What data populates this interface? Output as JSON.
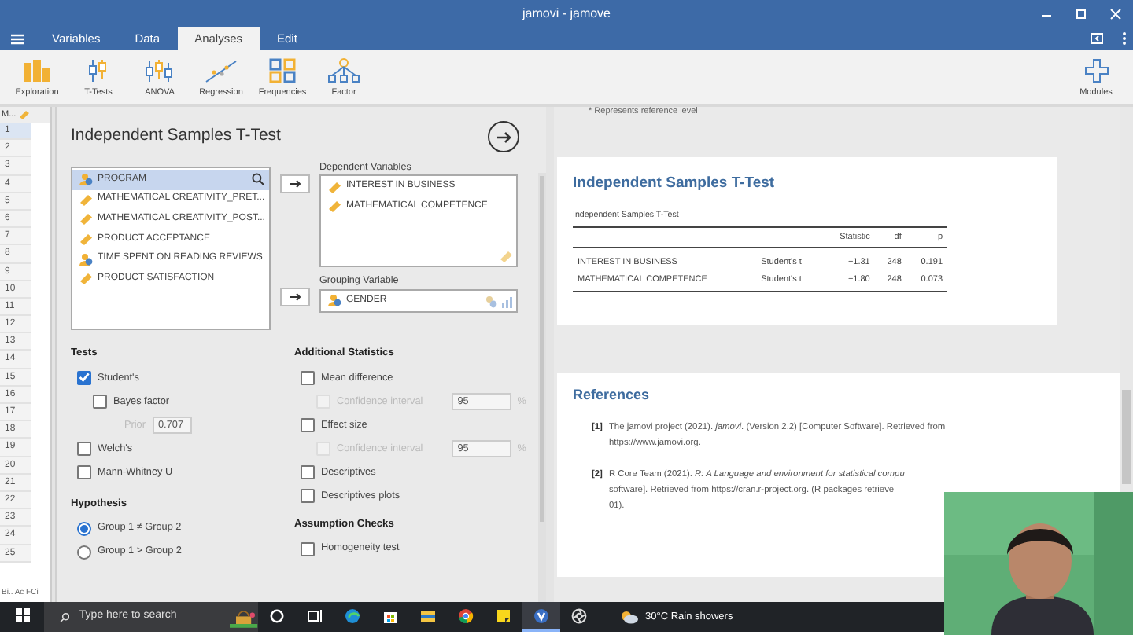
{
  "window": {
    "title": "jamovi - jamove"
  },
  "tabs": [
    {
      "label": "Variables",
      "selected": false
    },
    {
      "label": "Data",
      "selected": false
    },
    {
      "label": "Analyses",
      "selected": true
    },
    {
      "label": "Edit",
      "selected": false
    }
  ],
  "ribbon": [
    "Exploration",
    "T-Tests",
    "ANOVA",
    "Regression",
    "Frequencies",
    "Factor"
  ],
  "modules": "Modules",
  "spreadsheet": {
    "header": "M...",
    "rows": [
      {
        "label": "1",
        "selected": true
      },
      {
        "label": "2",
        "selected": false
      },
      {
        "label": "3",
        "selected": false
      },
      {
        "label": "4",
        "selected": false
      },
      {
        "label": "5",
        "selected": false
      },
      {
        "label": "6",
        "selected": false
      },
      {
        "label": "7",
        "selected": false
      },
      {
        "label": "8",
        "selected": false
      },
      {
        "label": "9",
        "selected": false
      },
      {
        "label": "10",
        "selected": false
      },
      {
        "label": "11",
        "selected": false
      },
      {
        "label": "12",
        "selected": false
      },
      {
        "label": "13",
        "selected": false
      },
      {
        "label": "14",
        "selected": false
      },
      {
        "label": "15",
        "selected": false
      },
      {
        "label": "16",
        "selected": false
      },
      {
        "label": "17",
        "selected": false
      },
      {
        "label": "18",
        "selected": false
      },
      {
        "label": "19",
        "selected": false
      },
      {
        "label": "20",
        "selected": false
      },
      {
        "label": "21",
        "selected": false
      },
      {
        "label": "22",
        "selected": false
      },
      {
        "label": "23",
        "selected": false
      },
      {
        "label": "24",
        "selected": false
      },
      {
        "label": "25",
        "selected": false
      }
    ],
    "footer": "Bi.. Ac FCi"
  },
  "analysis": {
    "title": "Independent Samples T-Test",
    "variables": [
      {
        "name": "PROGRAM",
        "kind": "nominal",
        "selected": true
      },
      {
        "name": "MATHEMATICAL CREATIVITY_PRET...",
        "kind": "continuous",
        "selected": false
      },
      {
        "name": "MATHEMATICAL CREATIVITY_POST...",
        "kind": "continuous",
        "selected": false
      },
      {
        "name": "PRODUCT ACCEPTANCE",
        "kind": "continuous",
        "selected": false
      },
      {
        "name": "TIME SPENT ON READING REVIEWS",
        "kind": "nominal",
        "selected": false
      },
      {
        "name": "PRODUCT SATISFACTION",
        "kind": "continuous",
        "selected": false
      }
    ],
    "dependent": {
      "label": "Dependent Variables",
      "items": [
        {
          "name": "INTEREST IN BUSINESS",
          "kind": "continuous"
        },
        {
          "name": "MATHEMATICAL COMPETENCE",
          "kind": "continuous"
        }
      ]
    },
    "grouping": {
      "label": "Grouping Variable",
      "items": [
        {
          "name": "GENDER",
          "kind": "nominal"
        }
      ]
    },
    "tests": {
      "label": "Tests",
      "items": [
        {
          "kind": "checkbox",
          "label": "Student's",
          "checked": true,
          "children": [
            {
              "kind": "checkbox",
              "label": "Bayes factor",
              "checked": false,
              "children": [
                {
                  "kind": "field",
                  "label": "Prior",
                  "value": "0.707",
                  "disabled": true
                }
              ]
            }
          ]
        },
        {
          "kind": "checkbox",
          "label": "Welch's",
          "checked": false
        },
        {
          "kind": "checkbox",
          "label": "Mann-Whitney U",
          "checked": false
        }
      ]
    },
    "hypothesis": {
      "label": "Hypothesis",
      "options": [
        {
          "label": "Group 1 ≠ Group 2",
          "selected": true
        },
        {
          "label": "Group 1 > Group 2",
          "selected": false
        }
      ]
    },
    "additional": {
      "label": "Additional Statistics",
      "items": [
        {
          "kind": "checkbox",
          "label": "Mean difference",
          "checked": false,
          "children": [
            {
              "kind": "checkbox-field",
              "label": "Confidence interval",
              "checked": false,
              "disabled": true,
              "value": "95",
              "unit": "%"
            }
          ]
        },
        {
          "kind": "checkbox",
          "label": "Effect size",
          "checked": false,
          "children": [
            {
              "kind": "checkbox-field",
              "label": "Confidence interval",
              "checked": false,
              "disabled": true,
              "value": "95",
              "unit": "%"
            }
          ]
        },
        {
          "kind": "checkbox",
          "label": "Descriptives",
          "checked": false
        },
        {
          "kind": "checkbox",
          "label": "Descriptives plots",
          "checked": false
        }
      ]
    },
    "assumptions": {
      "label": "Assumption Checks",
      "items": [
        {
          "kind": "checkbox",
          "label": "Homogeneity test",
          "checked": false
        }
      ]
    }
  },
  "results": {
    "note": "* Represents reference level",
    "heading": "Independent Samples T-Test",
    "table": {
      "caption": "Independent Samples T-Test",
      "columns": [
        "Statistic",
        "df",
        "p"
      ],
      "rows": [
        {
          "variable": "INTEREST IN BUSINESS",
          "test": "Student's t",
          "statistic": "−1.31",
          "df": "248",
          "p": "0.191"
        },
        {
          "variable": "MATHEMATICAL COMPETENCE",
          "test": "Student's t",
          "statistic": "−1.80",
          "df": "248",
          "p": "0.073"
        }
      ]
    },
    "references_heading": "References",
    "references": [
      {
        "number": "[1]",
        "lines": [
          {
            "text": "The jamovi project (2021). *jamovi*. (Version 2.2) [Computer Software]. Retrieved from"
          },
          {
            "link": "https://www.jamovi.org",
            "after": "."
          }
        ]
      },
      {
        "number": "[2]",
        "lines": [
          {
            "text": "R Core Team (2021). *R: A Language and environment for statistical compu*"
          },
          {
            "text": "software]. Retrieved from ",
            "link": "https://cran.r-project.org",
            "after": ". (R packages retrieve"
          },
          {
            "text": "01)."
          }
        ]
      }
    ]
  },
  "taskbar": {
    "search": {
      "placeholder": "Type here to search"
    },
    "apps": [
      {
        "selected": false
      },
      {
        "selected": false
      },
      {
        "selected": false
      },
      {
        "selected": false
      },
      {
        "selected": false
      },
      {
        "selected": false
      },
      {
        "selected": false
      },
      {
        "selected": true
      },
      {
        "selected": false
      }
    ],
    "weather": "30°C Rain showers"
  }
}
